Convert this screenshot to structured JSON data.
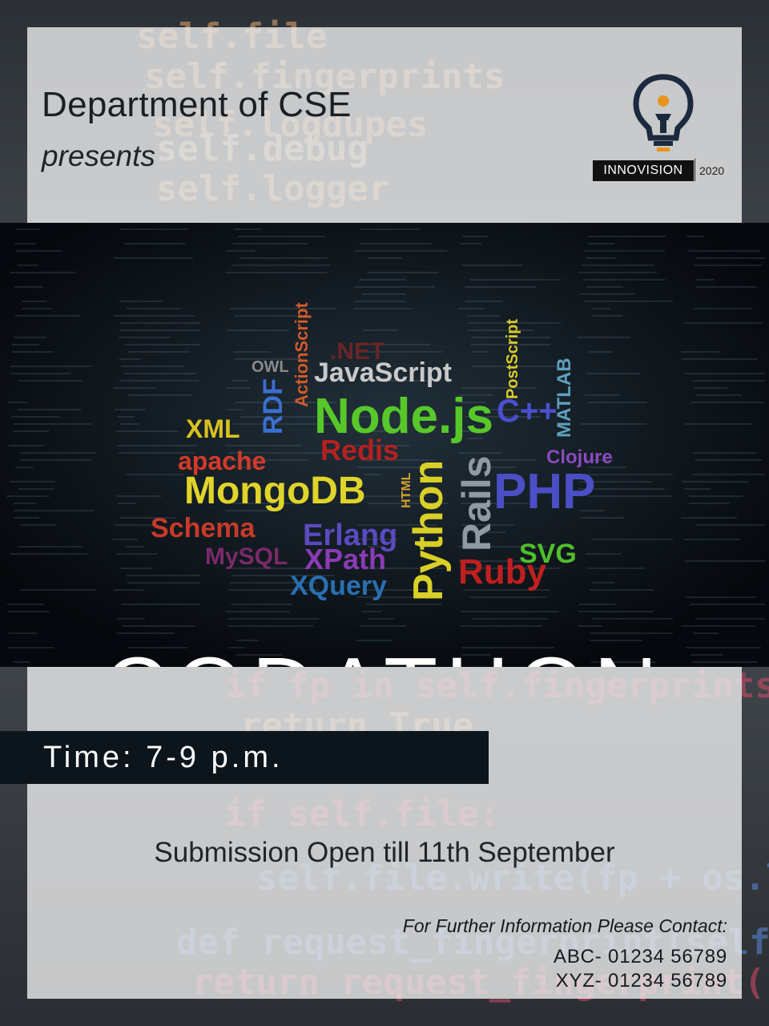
{
  "header": {
    "department": "Department of CSE",
    "presents": "presents"
  },
  "logo": {
    "brand": "INNOVISION",
    "year": "2020",
    "icon": "lightbulb-icon"
  },
  "event": {
    "title": "CODATHON",
    "time": "Time: 7-9 p.m.",
    "submission": "Submission Open till 11th September"
  },
  "contact": {
    "heading": "For Further Information Please Contact:",
    "lines": [
      "ABC- 01234 56789",
      "XYZ- 01234 56789"
    ]
  },
  "word_cloud": [
    {
      "text": "JavaScript",
      "color": "#c9c9c9"
    },
    {
      "text": "Node.js",
      "color": "#57c72a"
    },
    {
      "text": "XML",
      "color": "#d9c21f"
    },
    {
      "text": "apache",
      "color": "#d23a2a"
    },
    {
      "text": "MongoDB",
      "color": "#e0d42a"
    },
    {
      "text": "Schema",
      "color": "#c83a2a"
    },
    {
      "text": "Erlang",
      "color": "#5b4ac0"
    },
    {
      "text": "XPath",
      "color": "#8a3bb5"
    },
    {
      "text": "XQuery",
      "color": "#2a6fb0"
    },
    {
      "text": "Python",
      "color": "#d9d027"
    },
    {
      "text": "Rails",
      "color": "#8f9aa3"
    },
    {
      "text": "Ruby",
      "color": "#c01f1f"
    },
    {
      "text": "SVG",
      "color": "#4fbf2a"
    },
    {
      "text": "PHP",
      "color": "#4b4fc5"
    },
    {
      "text": "MATLAB",
      "color": "#5fa0c0"
    },
    {
      "text": "PostScript",
      "color": "#d9c92a"
    },
    {
      "text": "OWL",
      "color": "#8a8a8a"
    },
    {
      "text": "RDF",
      "color": "#3b6fd0"
    },
    {
      "text": "ActionScript",
      "color": "#d05a2a"
    },
    {
      "text": "Redis",
      "color": "#b52020"
    },
    {
      "text": "MySQL",
      "color": "#7a2a6a"
    },
    {
      "text": "HTML",
      "color": "#d4a22a"
    },
    {
      "text": ".NET",
      "color": "#6a2525"
    },
    {
      "text": "C++",
      "color": "#4a4fd0"
    },
    {
      "text": "Clojure",
      "color": "#8a4ac0"
    }
  ]
}
